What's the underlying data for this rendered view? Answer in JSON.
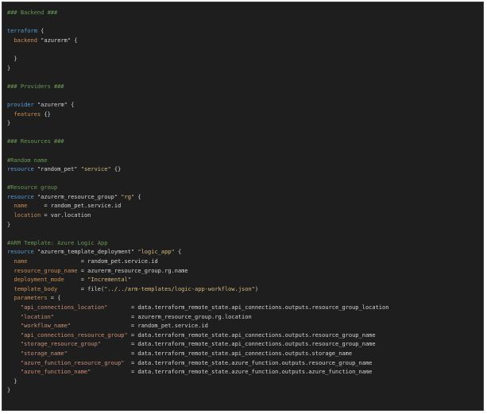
{
  "editor": {
    "lines": [
      [
        {
          "t": "### Backend ###",
          "c": "cm"
        }
      ],
      [],
      [
        {
          "t": "terraform",
          "c": "kw"
        },
        {
          "t": " {",
          "c": "pl"
        }
      ],
      [
        {
          "t": "  ",
          "c": "pl"
        },
        {
          "t": "backend",
          "c": "at"
        },
        {
          "t": " \"azurerm\" {",
          "c": "pl"
        }
      ],
      [],
      [
        {
          "t": "  }",
          "c": "pl"
        }
      ],
      [
        {
          "t": "}",
          "c": "pl"
        }
      ],
      [],
      [
        {
          "t": "### Providers ###",
          "c": "cm"
        }
      ],
      [],
      [
        {
          "t": "provider",
          "c": "kw"
        },
        {
          "t": " \"azurerm\" {",
          "c": "pl"
        }
      ],
      [
        {
          "t": "  ",
          "c": "pl"
        },
        {
          "t": "features",
          "c": "at"
        },
        {
          "t": " {}",
          "c": "pl"
        }
      ],
      [
        {
          "t": "}",
          "c": "pl"
        }
      ],
      [],
      [
        {
          "t": "### Resources ###",
          "c": "cm"
        }
      ],
      [],
      [
        {
          "t": "#Random name",
          "c": "cm"
        }
      ],
      [
        {
          "t": "resource",
          "c": "kw"
        },
        {
          "t": " \"random_pet\" ",
          "c": "pl"
        },
        {
          "t": "\"service\"",
          "c": "str"
        },
        {
          "t": " {}",
          "c": "pl"
        }
      ],
      [],
      [
        {
          "t": "#Resource group",
          "c": "cm"
        }
      ],
      [
        {
          "t": "resource",
          "c": "kw"
        },
        {
          "t": " \"azurerm_resource_group\" ",
          "c": "pl"
        },
        {
          "t": "\"rg\"",
          "c": "str"
        },
        {
          "t": " {",
          "c": "pl"
        }
      ],
      [
        {
          "t": "  ",
          "c": "pl"
        },
        {
          "t": "name",
          "c": "at"
        },
        {
          "t": "     = random_pet.service.id",
          "c": "pl"
        }
      ],
      [
        {
          "t": "  ",
          "c": "pl"
        },
        {
          "t": "location",
          "c": "at"
        },
        {
          "t": " = var.location",
          "c": "pl"
        }
      ],
      [
        {
          "t": "}",
          "c": "pl"
        }
      ],
      [],
      [
        {
          "t": "#ARM Template: Azure Logic App",
          "c": "cm"
        }
      ],
      [
        {
          "t": "resource",
          "c": "kw"
        },
        {
          "t": " \"azurerm_template_deployment\" ",
          "c": "pl"
        },
        {
          "t": "\"logic_app\"",
          "c": "str"
        },
        {
          "t": " {",
          "c": "pl"
        }
      ],
      [
        {
          "t": "  ",
          "c": "pl"
        },
        {
          "t": "name",
          "c": "at"
        },
        {
          "t": "                = random_pet.service.id",
          "c": "pl"
        }
      ],
      [
        {
          "t": "  ",
          "c": "pl"
        },
        {
          "t": "resource_group_name",
          "c": "at"
        },
        {
          "t": " = azurerm_resource_group.rg.name",
          "c": "pl"
        }
      ],
      [
        {
          "t": "  ",
          "c": "pl"
        },
        {
          "t": "deployment_mode",
          "c": "at"
        },
        {
          "t": "     = ",
          "c": "pl"
        },
        {
          "t": "\"Incremental\"",
          "c": "str"
        }
      ],
      [
        {
          "t": "  ",
          "c": "pl"
        },
        {
          "t": "template_body",
          "c": "at"
        },
        {
          "t": "       = file(",
          "c": "pl"
        },
        {
          "t": "\"../../arm-templates/logic-app-workflow.json\"",
          "c": "str"
        },
        {
          "t": ")",
          "c": "pl"
        }
      ],
      [
        {
          "t": "  ",
          "c": "pl"
        },
        {
          "t": "parameters",
          "c": "at"
        },
        {
          "t": " = {",
          "c": "pl"
        }
      ],
      [
        {
          "t": "    ",
          "c": "pl"
        },
        {
          "t": "\"api_connections_location\"",
          "c": "st2"
        },
        {
          "t": "       = data.terraform_remote_state.api_connections.outputs.resource_group_location",
          "c": "pl"
        }
      ],
      [
        {
          "t": "    ",
          "c": "pl"
        },
        {
          "t": "\"location\"",
          "c": "st2"
        },
        {
          "t": "                       = azurerm_resource_group.rg.location",
          "c": "pl"
        }
      ],
      [
        {
          "t": "    ",
          "c": "pl"
        },
        {
          "t": "\"workflow_name\"",
          "c": "st2"
        },
        {
          "t": "                  = random_pet.service.id",
          "c": "pl"
        }
      ],
      [
        {
          "t": "    ",
          "c": "pl"
        },
        {
          "t": "\"api_connections_resource_group\"",
          "c": "st2"
        },
        {
          "t": " = data.terraform_remote_state.api_connections.outputs.resource_group_name",
          "c": "pl"
        }
      ],
      [
        {
          "t": "    ",
          "c": "pl"
        },
        {
          "t": "\"storage_resource_group\"",
          "c": "st2"
        },
        {
          "t": "         = data.terraform_remote_state.api_connections.outputs.resource_group_name",
          "c": "pl"
        }
      ],
      [
        {
          "t": "    ",
          "c": "pl"
        },
        {
          "t": "\"storage_name\"",
          "c": "st2"
        },
        {
          "t": "                   = data.terraform_remote_state.api_connections.outputs.storage_name",
          "c": "pl"
        }
      ],
      [
        {
          "t": "    ",
          "c": "pl"
        },
        {
          "t": "\"azure_function_resource_group\"",
          "c": "st2"
        },
        {
          "t": "  = data.terraform_remote_state.azure_function.outputs.resource_group_name",
          "c": "pl"
        }
      ],
      [
        {
          "t": "    ",
          "c": "pl"
        },
        {
          "t": "\"azure_function_name\"",
          "c": "st2"
        },
        {
          "t": "            = data.terraform_remote_state.azure_function.outputs.azure_function_name",
          "c": "pl"
        }
      ],
      [
        {
          "t": "  }",
          "c": "pl"
        }
      ],
      [
        {
          "t": "}",
          "c": "pl"
        }
      ]
    ]
  }
}
